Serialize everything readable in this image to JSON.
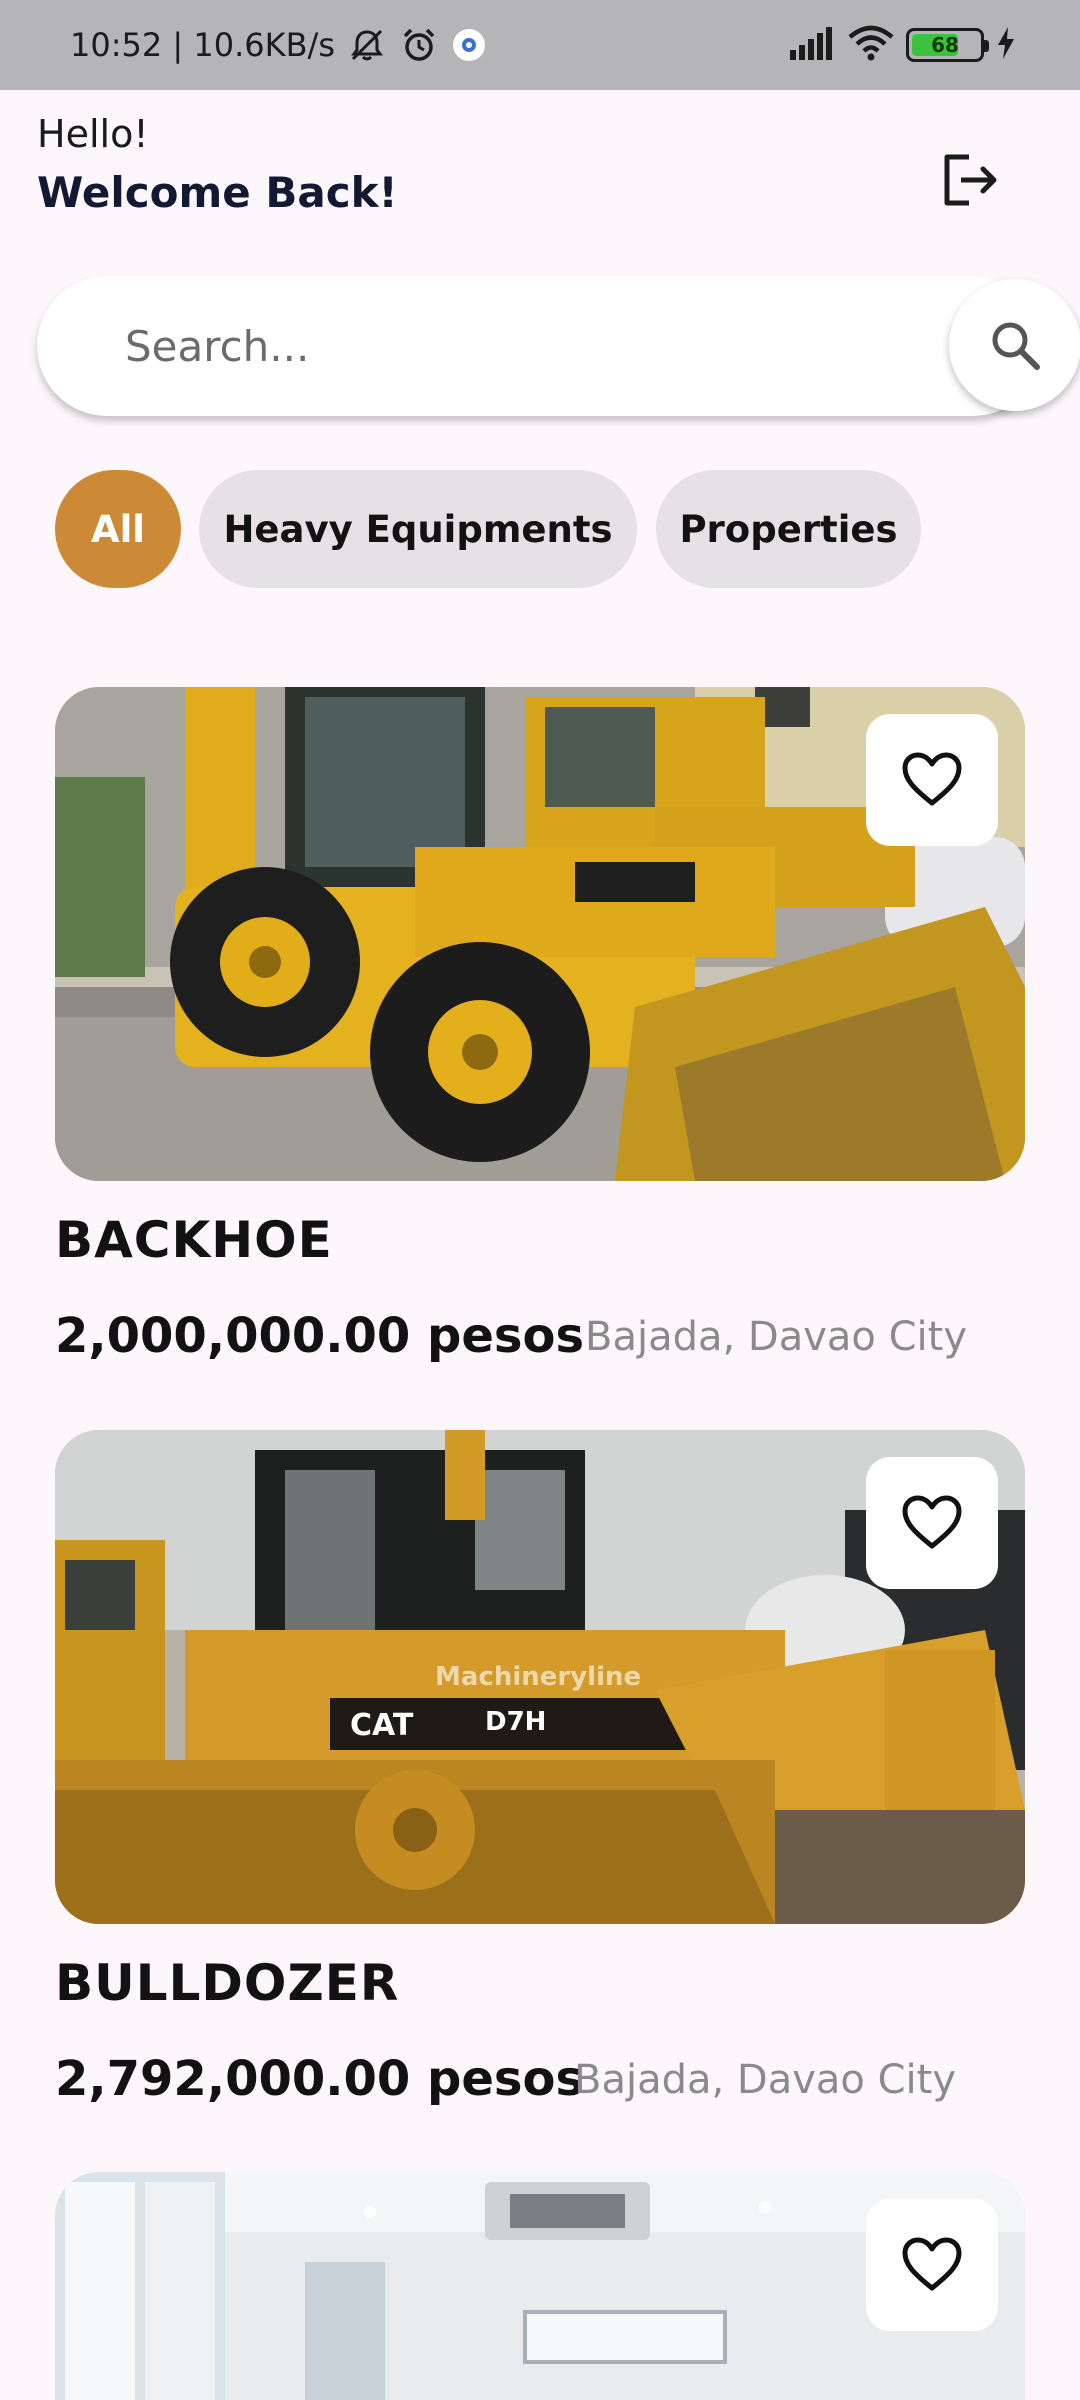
{
  "status_bar": {
    "time_speed": "10:52 | 10.6KB/s",
    "battery_level": "68",
    "icons": [
      "mute-icon",
      "alarm-icon",
      "app-notification-icon",
      "signal-icon",
      "wifi-icon",
      "battery-icon",
      "charging-icon"
    ]
  },
  "header": {
    "greeting": "Hello!",
    "welcome": "Welcome Back!",
    "logout_icon": "logout-icon"
  },
  "search": {
    "placeholder": "Search...",
    "button_icon": "search-icon"
  },
  "categories": [
    {
      "label": "All",
      "selected": true
    },
    {
      "label": "Heavy Equipments",
      "selected": false
    },
    {
      "label": "Properties",
      "selected": false
    }
  ],
  "colors": {
    "accent": "#cc8a36",
    "chip_inactive": "#e6e1e4",
    "background": "#fdf7fb",
    "status_bar": "#b5b5b8",
    "heading": "#121a33",
    "location_text": "#8a8a8a"
  },
  "listings": [
    {
      "title": "BACKHOE",
      "price": "2,000,000.00 pesos",
      "location": "Bajada, Davao City",
      "favorite_icon": "heart-outline-icon"
    },
    {
      "title": "BULLDOZER",
      "price": "2,792,000.00 pesos",
      "location": "Bajada, Davao City",
      "favorite_icon": "heart-outline-icon",
      "image_watermark": "Machineryline"
    },
    {
      "favorite_icon": "heart-outline-icon"
    }
  ]
}
